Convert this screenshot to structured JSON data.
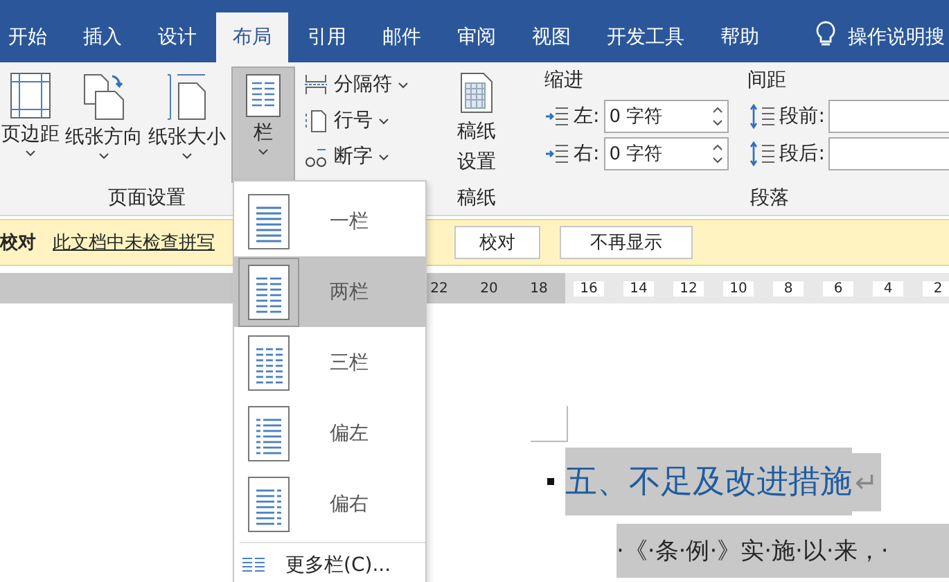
{
  "tabs": [
    {
      "label": "开始",
      "selected": false
    },
    {
      "label": "插入",
      "selected": false
    },
    {
      "label": "设计",
      "selected": false
    },
    {
      "label": "布局",
      "selected": true
    },
    {
      "label": "引用",
      "selected": false
    },
    {
      "label": "邮件",
      "selected": false
    },
    {
      "label": "审阅",
      "selected": false
    },
    {
      "label": "视图",
      "selected": false
    },
    {
      "label": "开发工具",
      "selected": false
    },
    {
      "label": "帮助",
      "selected": false
    }
  ],
  "search": {
    "placeholder": "操作说明搜"
  },
  "page_setup": {
    "label": "页面设置",
    "large_buttons": [
      {
        "label": "页边距",
        "pressed": false
      },
      {
        "label": "纸张方向",
        "pressed": false
      },
      {
        "label": "纸张大小",
        "pressed": false
      },
      {
        "label": "栏",
        "pressed": true
      }
    ],
    "small_buttons": [
      {
        "label": "分隔符"
      },
      {
        "label": "行号"
      },
      {
        "label": "断字"
      }
    ]
  },
  "draft_paper": {
    "label": "稿纸",
    "button": "稿纸设置"
  },
  "paragraph": {
    "label": "段落",
    "indent": {
      "title": "缩进",
      "fields": [
        {
          "label": "左:",
          "value": "0 字符"
        },
        {
          "label": "右:",
          "value": "0 字符"
        }
      ]
    },
    "spacing": {
      "title": "间距",
      "fields": [
        {
          "label": "段前:"
        },
        {
          "label": "段后:"
        }
      ]
    }
  },
  "message_bar": {
    "title": "校对",
    "link": "此文档中未检查拼写",
    "buttons": [
      "校对",
      "不再显示"
    ]
  },
  "ruler": {
    "marks": [
      "22",
      "20",
      "18",
      "16",
      "14",
      "12",
      "10",
      "8",
      "6",
      "4",
      "2"
    ]
  },
  "document": {
    "heading": "五、不足及改进措施",
    "paragraph_mark": "↵",
    "body": "·《·条·例·》实·施·以·来，·"
  },
  "columns_menu": {
    "items": [
      {
        "label": "一栏",
        "selected": false
      },
      {
        "label": "两栏",
        "selected": true
      },
      {
        "label": "三栏",
        "selected": false
      },
      {
        "label": "偏左",
        "selected": false
      },
      {
        "label": "偏右",
        "selected": false
      }
    ],
    "more": "更多栏(C)..."
  }
}
